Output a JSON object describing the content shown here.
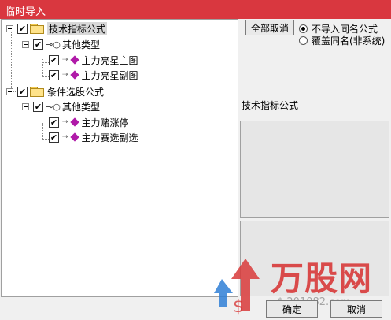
{
  "window": {
    "title": "临时导入"
  },
  "tree": {
    "groups": [
      {
        "label": "技术指标公式",
        "checked": true,
        "selected": true,
        "subgroup": {
          "label": "其他类型",
          "checked": true,
          "items": [
            {
              "label": "主力亮星主图",
              "checked": true
            },
            {
              "label": "主力亮星副图",
              "checked": true
            }
          ]
        }
      },
      {
        "label": "条件选股公式",
        "checked": true,
        "selected": false,
        "subgroup": {
          "label": "其他类型",
          "checked": true,
          "items": [
            {
              "label": "主力赌涨停",
              "checked": true
            },
            {
              "label": "主力赛选副选",
              "checked": true
            }
          ]
        }
      }
    ]
  },
  "options": {
    "cancel_all_label": "全部取消",
    "radio_options": [
      {
        "label": "不导入同名公式",
        "checked": true
      },
      {
        "label": "覆盖同名(非系统)",
        "checked": false
      }
    ],
    "section_label": "技术指标公式"
  },
  "watermark": {
    "text": "万股网",
    "url": "$ 201082.com"
  },
  "footer": {
    "ok_label": "确定",
    "cancel_label": "取消"
  },
  "colors": {
    "titlebar": "#d9373f",
    "check_mark": "#000000",
    "item_icon": "#b01aa8"
  }
}
